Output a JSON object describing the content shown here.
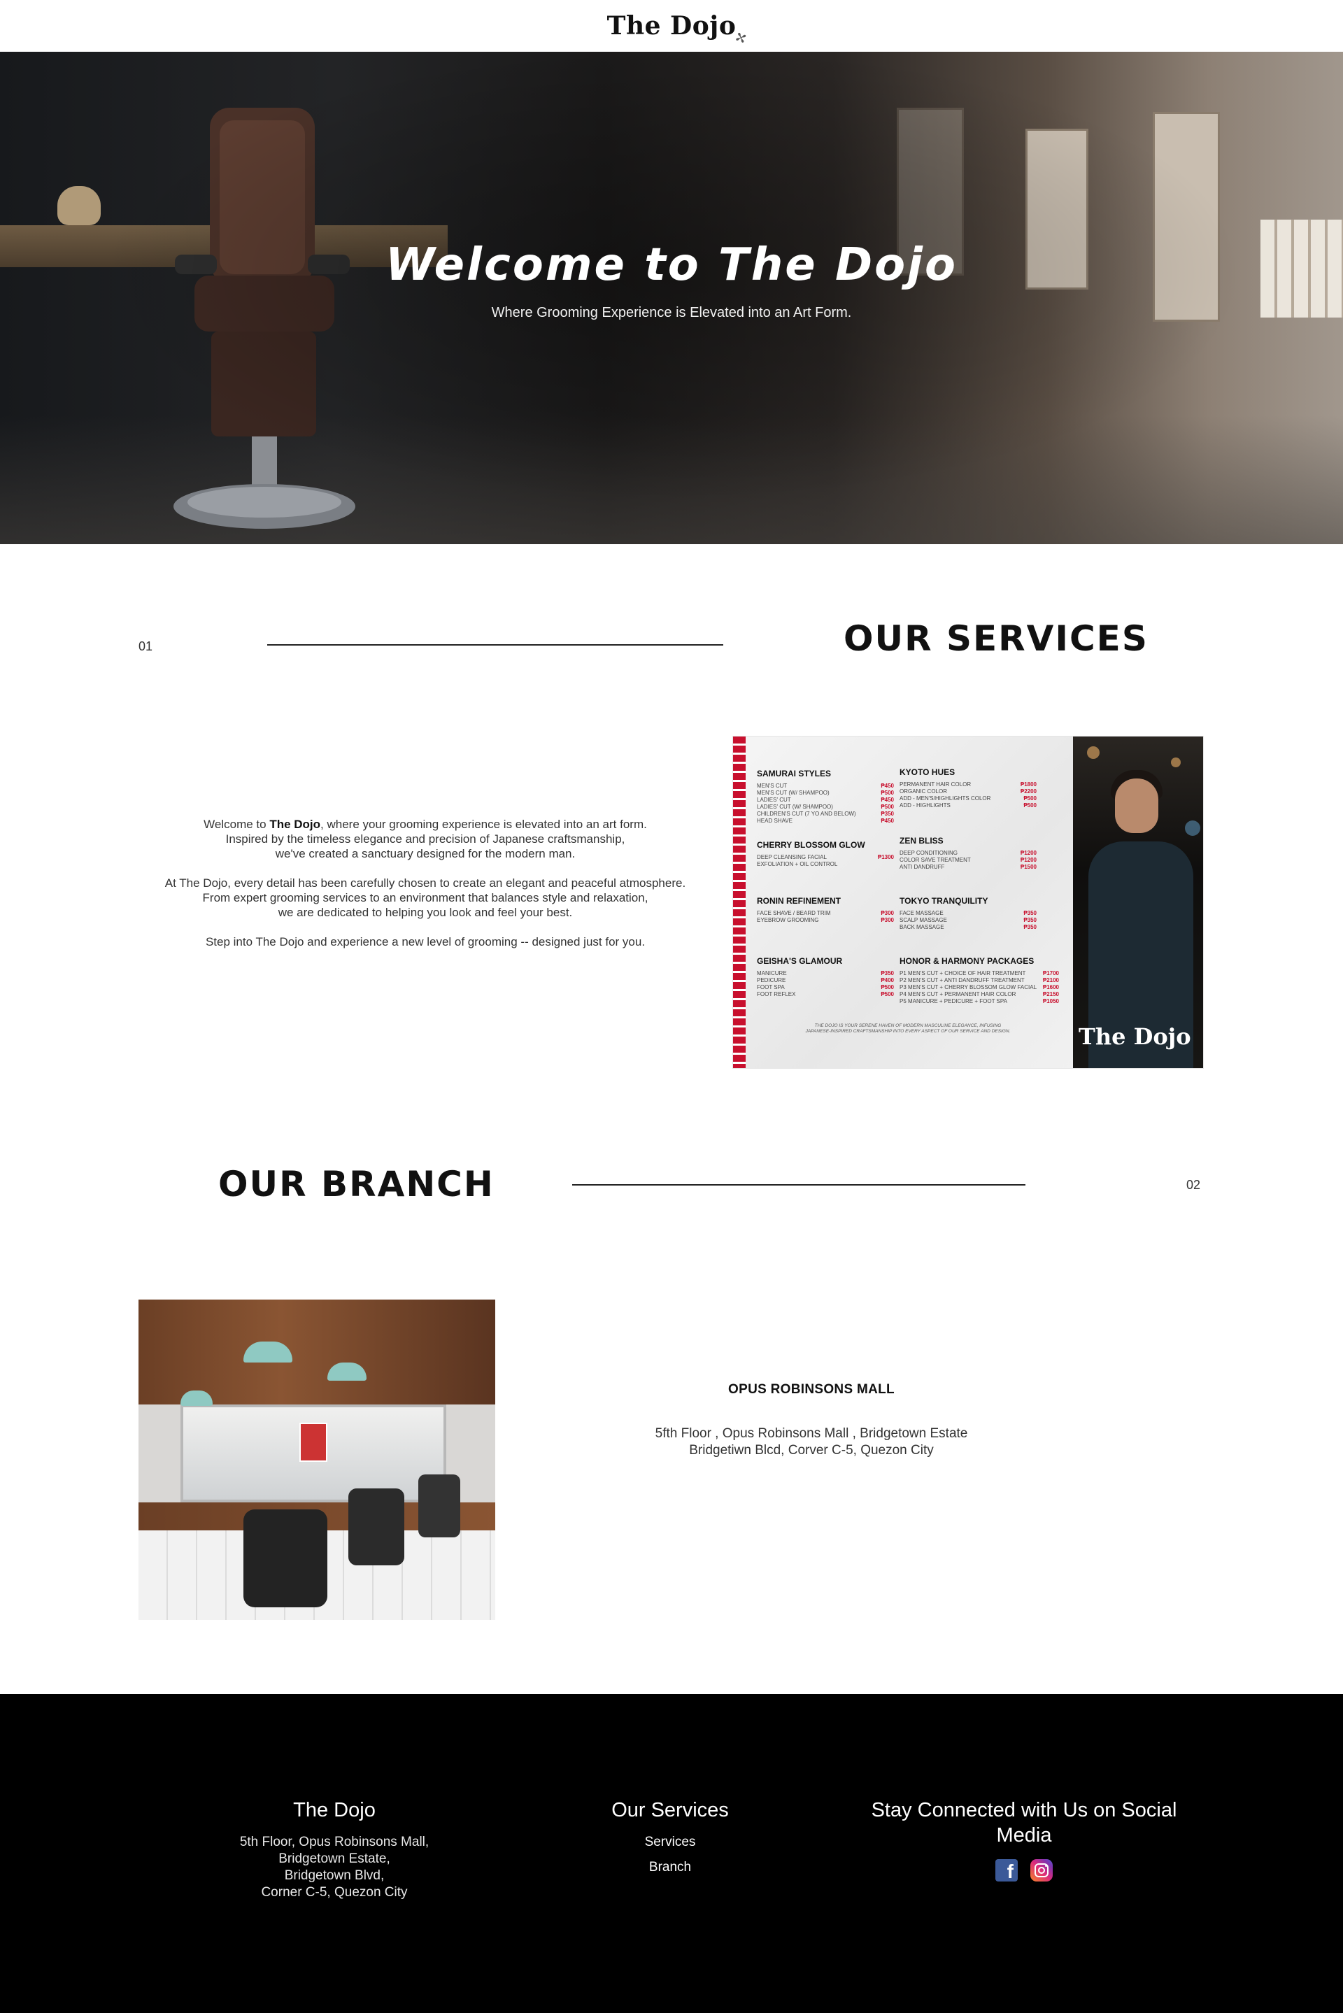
{
  "header": {
    "logo": "The Dojo"
  },
  "hero": {
    "title": "Welcome to The Dojo",
    "subtitle": "Where Grooming Experience is Elevated into an Art Form."
  },
  "services": {
    "number": "01",
    "title": "OUR SERVICES",
    "intro": {
      "p1_prefix": "Welcome to ",
      "p1_brand": "The Dojo",
      "p1_suffix": ", where your grooming experience is elevated into an art form.\nInspired by the timeless elegance and precision of Japanese craftsmanship,\nwe've created a sanctuary designed for the modern man.",
      "p2": "At The Dojo, every detail has been carefully chosen to create an elegant and peaceful atmosphere.\nFrom expert grooming services to an environment that balances style and relaxation,\nwe are dedicated to helping you look and feel your best.",
      "p3": "Step into The Dojo and experience a new level of grooming -- designed just for you."
    },
    "menu": {
      "brand": "The Dojo",
      "note": "THE DOJO IS YOUR SERENE HAVEN OF MODERN MASCULINE ELEGANCE, INFUSING JAPANESE-INSPIRED CRAFTSMANSHIP INTO EVERY ASPECT OF OUR SERVICE AND DESIGN.",
      "categories": [
        {
          "name": "SAMURAI STYLES",
          "items": [
            [
              "MEN'S CUT",
              "₱450"
            ],
            [
              "MEN'S CUT (W/ SHAMPOO)",
              "₱500"
            ],
            [
              "LADIES' CUT",
              "₱450"
            ],
            [
              "LADIES' CUT (W/ SHAMPOO)",
              "₱500"
            ],
            [
              "CHILDREN'S CUT (7 YO AND BELOW)",
              "₱350"
            ],
            [
              "HEAD SHAVE",
              "₱450"
            ]
          ]
        },
        {
          "name": "KYOTO HUES",
          "items": [
            [
              "PERMANENT HAIR COLOR",
              "₱1800"
            ],
            [
              "ORGANIC COLOR",
              "₱2200"
            ],
            [
              "ADD - MEN'S/HIGHLIGHTS COLOR",
              "₱500"
            ],
            [
              "ADD - HIGHLIGHTS",
              "₱500"
            ]
          ]
        },
        {
          "name": "CHERRY BLOSSOM GLOW",
          "items": [
            [
              "DEEP CLEANSING FACIAL",
              "₱1300"
            ],
            [
              "EXFOLIATION + OIL CONTROL",
              ""
            ]
          ]
        },
        {
          "name": "ZEN BLISS",
          "items": [
            [
              "DEEP CONDITIONING",
              "₱1200"
            ],
            [
              "COLOR SAVE TREATMENT",
              "₱1200"
            ],
            [
              "ANTI DANDRUFF",
              "₱1500"
            ]
          ]
        },
        {
          "name": "RONIN REFINEMENT",
          "items": [
            [
              "FACE SHAVE / BEARD TRIM",
              "₱300"
            ],
            [
              "EYEBROW GROOMING",
              "₱300"
            ]
          ]
        },
        {
          "name": "TOKYO TRANQUILITY",
          "items": [
            [
              "FACE MASSAGE",
              "₱350"
            ],
            [
              "SCALP MASSAGE",
              "₱350"
            ],
            [
              "BACK MASSAGE",
              "₱350"
            ]
          ]
        },
        {
          "name": "GEISHA'S GLAMOUR",
          "items": [
            [
              "MANICURE",
              "₱350"
            ],
            [
              "PEDICURE",
              "₱400"
            ],
            [
              "FOOT SPA",
              "₱500"
            ],
            [
              "FOOT REFLEX",
              "₱500"
            ]
          ]
        },
        {
          "name": "HONOR & HARMONY PACKAGES",
          "items": [
            [
              "P1 MEN'S CUT + CHOICE OF HAIR TREATMENT",
              "₱1700"
            ],
            [
              "P2 MEN'S CUT + ANTI DANDRUFF TREATMENT",
              "₱2100"
            ],
            [
              "P3 MEN'S CUT + CHERRY BLOSSOM GLOW FACIAL",
              "₱1600"
            ],
            [
              "P4 MEN'S CUT + PERMANENT HAIR COLOR",
              "₱2150"
            ],
            [
              "P5 MANICURE + PEDICURE + FOOT SPA",
              "₱1050"
            ]
          ]
        }
      ]
    }
  },
  "branch": {
    "number": "02",
    "title": "OUR BRANCH",
    "name": "OPUS ROBINSONS MALL",
    "address_line1": "5fth Floor , Opus Robinsons Mall , Bridgetown Estate",
    "address_line2": "Bridgetiwn Blcd, Corver C-5, Quezon City"
  },
  "footer": {
    "col1": {
      "title": "The Dojo",
      "lines": [
        "5th Floor, Opus Robinsons Mall,",
        "Bridgetown Estate,",
        "Bridgetown Blvd,",
        "Corner C-5, Quezon City"
      ]
    },
    "col2": {
      "title": "Our Services",
      "links": [
        "Services",
        "Branch"
      ]
    },
    "col3": {
      "title": "Stay Connected with Us on Social Media",
      "icons": [
        "facebook-icon",
        "instagram-icon"
      ]
    }
  }
}
